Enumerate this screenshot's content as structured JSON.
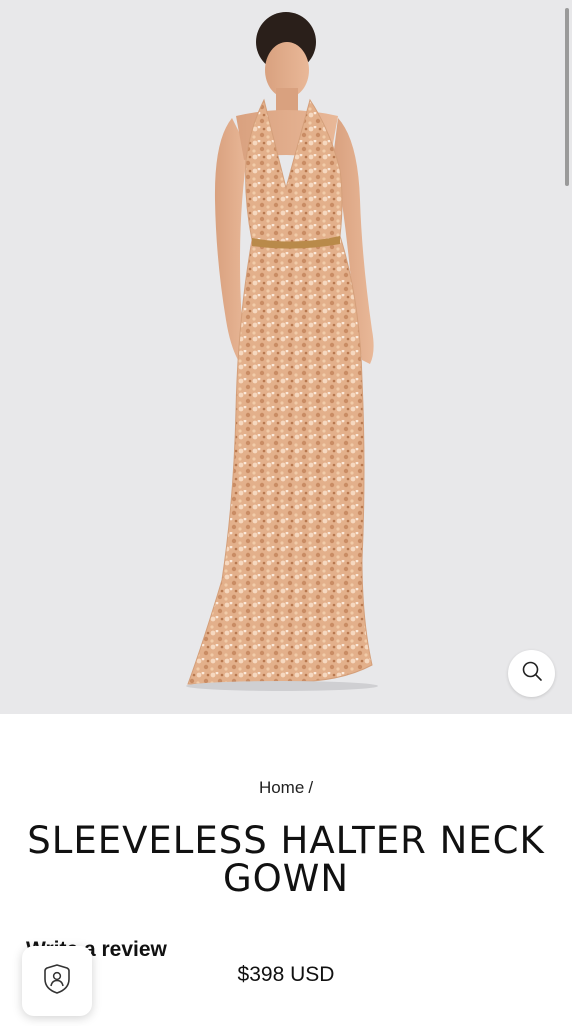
{
  "product": {
    "image_alt": "Model wearing a rose gold sequin halter neck gown",
    "title": "SLEEVELESS HALTER NECK GOWN",
    "review_label": "Write a review",
    "price": "$398 USD"
  },
  "breadcrumb": {
    "home": "Home",
    "separator": "/"
  },
  "icons": {
    "zoom": "search-icon",
    "account": "account-shield-icon"
  },
  "colors": {
    "image_background": "#e8e8ea",
    "dress": "#e6b48f"
  }
}
